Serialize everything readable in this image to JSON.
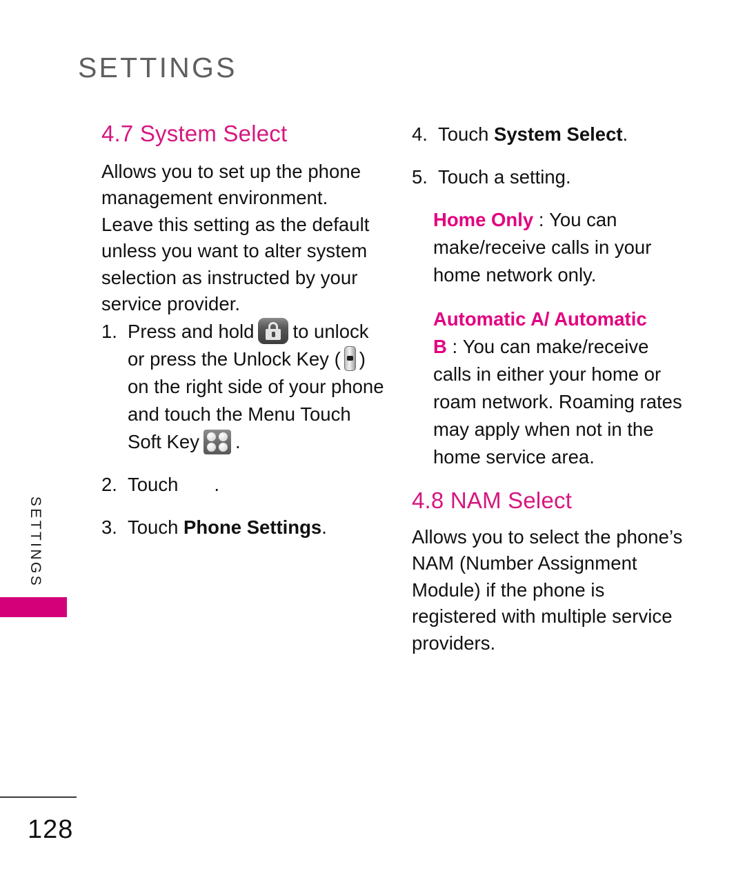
{
  "page": {
    "chapter_title": "SETTINGS",
    "side_tab_label": "SETTINGS",
    "page_number": "128",
    "accent_pink": "#d6177f",
    "term_pink": "#e2007f",
    "tab_bar_color": "#d4007a",
    "head_gray": "#5f5f5f"
  },
  "left_column": {
    "section_title": "4.7 System Select",
    "intro": "Allows you to set up the phone management environment. Leave this setting as the default unless you want to alter system selection as instructed by your service provider.",
    "steps": [
      {
        "num": "1.",
        "part1": "Press and hold",
        "icon1": "lock-key-icon",
        "part2": "to unlock or press the Unlock Key (",
        "icon2": "side-unlock-key-icon",
        "part3": ") on the right side of your phone and touch the Menu Touch Soft Key",
        "icon3": "menu-soft-key-icon",
        "part4": "."
      },
      {
        "num": "2.",
        "part1": "Touch",
        "icon1": "missing-icon",
        "part2": "."
      },
      {
        "num": "3.",
        "part1": "Touch",
        "bold": "Phone Settings",
        "part2": "."
      }
    ]
  },
  "right_column": {
    "steps": [
      {
        "num": "4.",
        "part1": "Touch",
        "bold": "System Select",
        "part2": "."
      },
      {
        "num": "5.",
        "part1": "Touch a setting.",
        "bold": "",
        "part2": ""
      }
    ],
    "settings": [
      {
        "term": "Home Only",
        "separator": ":",
        "description": "You can make/receive calls in your home network only."
      },
      {
        "term": "Automatic A/ Automatic B",
        "separator": ":",
        "description": "You can make/receive calls in either your home or roam network. Roaming rates may apply when not in the home service area."
      }
    ],
    "section_title": "4.8 NAM Select",
    "section_body": "Allows you to select the phone’s NAM (Number Assignment Module) if the phone is registered with multiple service providers."
  }
}
